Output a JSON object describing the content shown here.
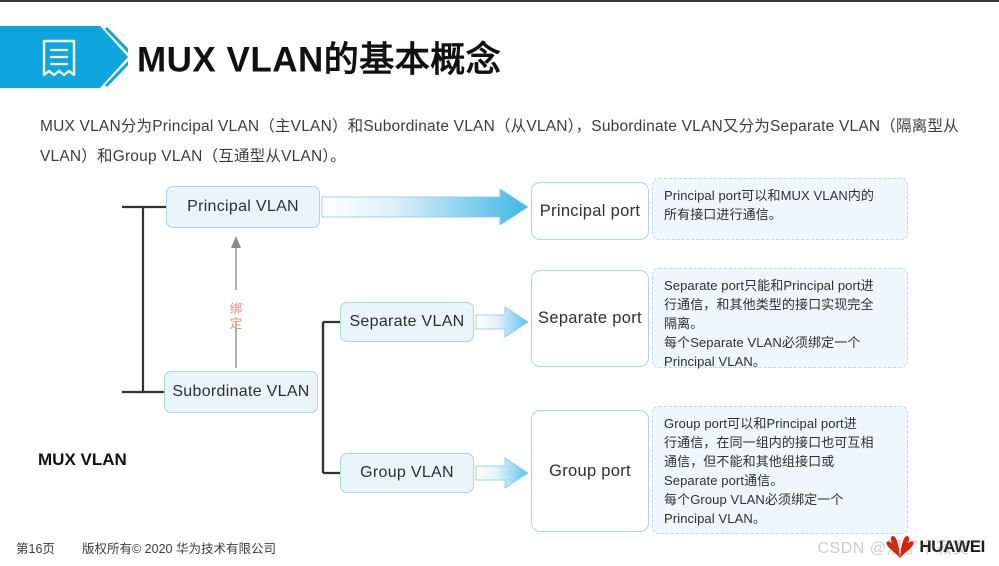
{
  "header": {
    "title": "MUX VLAN的基本概念",
    "icon": "document-icon",
    "banner_color": "#0fa6e0"
  },
  "intro": {
    "text": "MUX VLAN分为Principal VLAN（主VLAN）和Subordinate VLAN（从VLAN），Subordinate VLAN又分为Separate VLAN（隔离型从VLAN）和Group VLAN（互通型从VLAN）。"
  },
  "diagram": {
    "root_label": "MUX VLAN",
    "bind_label": "绑定",
    "bind_color": "#e8897c",
    "box_border_color": "#a9d6e8",
    "vlan_fill": "#eaf4fb",
    "boxes": {
      "principal_vlan": "Principal VLAN",
      "subordinate_vlan": "Subordinate VLAN",
      "separate_vlan": "Separate VLAN",
      "group_vlan": "Group VLAN",
      "principal_port": "Principal port",
      "separate_port": "Separate port",
      "group_port": "Group port"
    },
    "descriptions": {
      "principal": [
        "Principal port可以和MUX VLAN内的",
        "所有接口进行通信。"
      ],
      "separate": [
        "Separate port只能和Principal port进",
        "行通信，和其他类型的接口实现完全",
        "隔离。",
        "每个Separate VLAN必须绑定一个",
        "Principal VLAN。"
      ],
      "group": [
        "Group port可以和Principal port进",
        "行通信，在同一组内的接口也可互相",
        "通信，但不能和其他组接口或",
        "Separate port通信。",
        "每个Group VLAN必须绑定一个",
        "Principal VLAN。"
      ]
    }
  },
  "footer": {
    "page_number": "第16页",
    "copyright": "版权所有© 2020 华为技术有限公司",
    "logo_text": "HUAWEI",
    "watermark": "CSDN @混了个寂寞"
  }
}
